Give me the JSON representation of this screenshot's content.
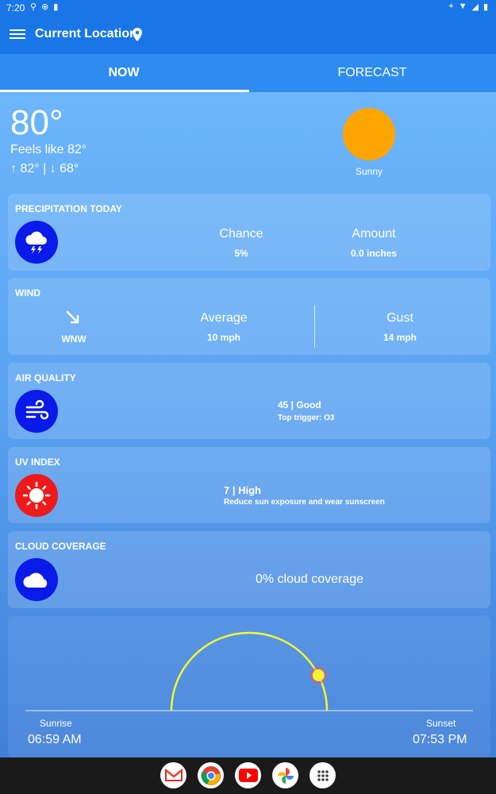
{
  "status": {
    "time": "7:20"
  },
  "appbar": {
    "title": "Current Location"
  },
  "tabs": [
    {
      "label": "NOW"
    },
    {
      "label": "FORECAST"
    }
  ],
  "current": {
    "temp": "80°",
    "feels_like": "Feels like 82°",
    "hilo": "↑ 82° | ↓ 68°",
    "condition": "Sunny"
  },
  "precipitation": {
    "title": "PRECIPITATION TODAY",
    "chance_label": "Chance",
    "chance_value": "5%",
    "amount_label": "Amount",
    "amount_value": "0.0 inches"
  },
  "wind": {
    "title": "WIND",
    "direction": "WNW",
    "average_label": "Average",
    "average_value": "10 mph",
    "gust_label": "Gust",
    "gust_value": "14 mph"
  },
  "air_quality": {
    "title": "AIR QUALITY",
    "value": "45 | Good",
    "trigger": "Top trigger: O3"
  },
  "uv": {
    "title": "UV INDEX",
    "value": "7 | High",
    "advice": "Reduce sun exposure and wear sunscreen"
  },
  "cloud": {
    "title": "CLOUD COVERAGE",
    "value": "0% cloud coverage"
  },
  "sun": {
    "sunrise_label": "Sunrise",
    "sunrise_time": "06:59 AM",
    "sunset_label": "Sunset",
    "sunset_time": "07:53 PM",
    "day_progress": 0.85
  },
  "colors": {
    "appbar": "#1976e6",
    "sun": "#ffa500",
    "icon_blue": "#0a1ae8",
    "icon_red": "#ee1a1a",
    "arc": "#f5f531"
  },
  "dock": [
    {
      "icon": "gmail-icon"
    },
    {
      "icon": "chrome-icon"
    },
    {
      "icon": "youtube-icon"
    },
    {
      "icon": "photos-icon"
    },
    {
      "icon": "app-drawer-icon"
    }
  ]
}
